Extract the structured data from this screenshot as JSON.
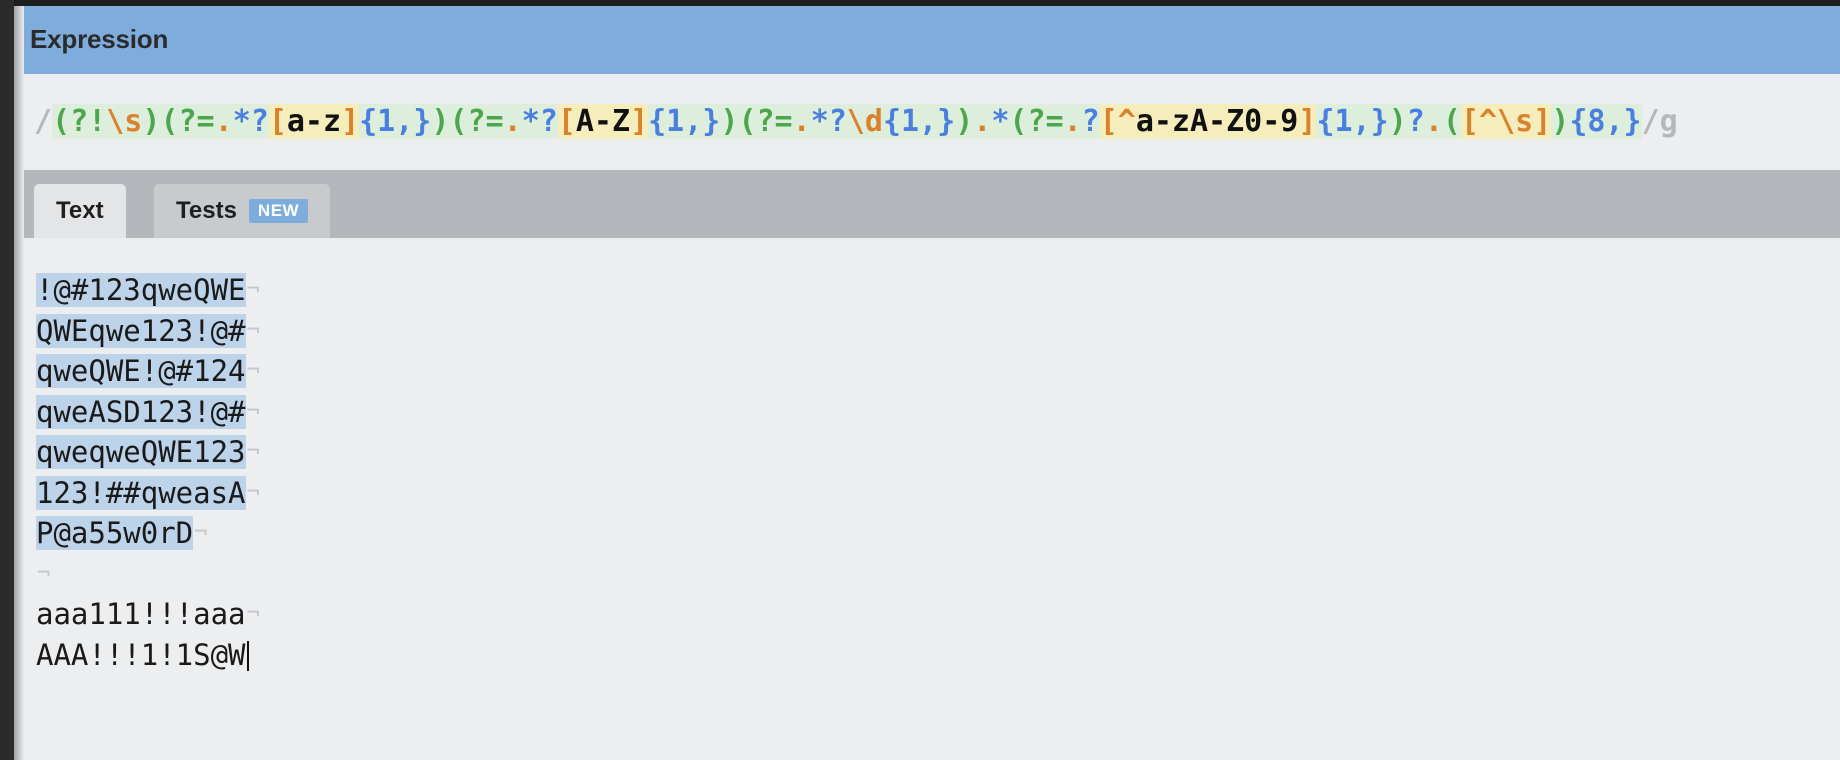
{
  "app": {
    "name": "regex-tester",
    "accent_color": "#7eaddd",
    "background_color": "#eceef0",
    "tabbar_color": "#b4b8bc",
    "match_highlight_color": "#bdd3ea"
  },
  "header": {
    "title": "Expression"
  },
  "expression": {
    "full_text": "/(?!\\s)(?=.*?[a-z]{1,})(?=.*?[A-Z]{1,})(?=.*?\\d{1,}).*(?=.?[^a-zA-Z0-9]{1,})?.([^\\s]){8,}/g",
    "open_delimiter": "/",
    "close_delimiter": "/",
    "flags": "g",
    "tokens": [
      {
        "text": "/",
        "kind": "delim"
      },
      {
        "text": "(",
        "kind": "group"
      },
      {
        "text": "?!",
        "kind": "group"
      },
      {
        "text": "\\s",
        "kind": "esc"
      },
      {
        "text": ")",
        "kind": "group"
      },
      {
        "text": "(",
        "kind": "group"
      },
      {
        "text": "?=",
        "kind": "group"
      },
      {
        "text": ".",
        "kind": "dot"
      },
      {
        "text": "*",
        "kind": "star"
      },
      {
        "text": "?",
        "kind": "qm"
      },
      {
        "text": "[",
        "kind": "esc-class"
      },
      {
        "text": "a-z",
        "kind": "lit-class"
      },
      {
        "text": "]",
        "kind": "esc-class"
      },
      {
        "text": "{1,}",
        "kind": "meta"
      },
      {
        "text": ")",
        "kind": "group"
      },
      {
        "text": "(",
        "kind": "group"
      },
      {
        "text": "?=",
        "kind": "group"
      },
      {
        "text": ".",
        "kind": "dot"
      },
      {
        "text": "*",
        "kind": "star"
      },
      {
        "text": "?",
        "kind": "qm"
      },
      {
        "text": "[",
        "kind": "esc-class"
      },
      {
        "text": "A-Z",
        "kind": "lit-class"
      },
      {
        "text": "]",
        "kind": "esc-class"
      },
      {
        "text": "{1,}",
        "kind": "meta"
      },
      {
        "text": ")",
        "kind": "group"
      },
      {
        "text": "(",
        "kind": "group"
      },
      {
        "text": "?=",
        "kind": "group"
      },
      {
        "text": ".",
        "kind": "dot"
      },
      {
        "text": "*",
        "kind": "star"
      },
      {
        "text": "?",
        "kind": "qm"
      },
      {
        "text": "\\d",
        "kind": "esc"
      },
      {
        "text": "{1,}",
        "kind": "meta"
      },
      {
        "text": ")",
        "kind": "group"
      },
      {
        "text": ".",
        "kind": "dot"
      },
      {
        "text": "*",
        "kind": "star"
      },
      {
        "text": "(",
        "kind": "group"
      },
      {
        "text": "?=",
        "kind": "group"
      },
      {
        "text": ".",
        "kind": "dot"
      },
      {
        "text": "?",
        "kind": "qm"
      },
      {
        "text": "[",
        "kind": "esc-class"
      },
      {
        "text": "^",
        "kind": "esc-class"
      },
      {
        "text": "a-zA-Z0-9",
        "kind": "lit-class"
      },
      {
        "text": "]",
        "kind": "esc-class"
      },
      {
        "text": "{1,}",
        "kind": "meta"
      },
      {
        "text": ")",
        "kind": "group"
      },
      {
        "text": "?",
        "kind": "qm"
      },
      {
        "text": ".",
        "kind": "dot"
      },
      {
        "text": "(",
        "kind": "group"
      },
      {
        "text": "[",
        "kind": "esc-class"
      },
      {
        "text": "^",
        "kind": "esc-class"
      },
      {
        "text": "\\s",
        "kind": "esc-class"
      },
      {
        "text": "]",
        "kind": "esc-class"
      },
      {
        "text": ")",
        "kind": "group"
      },
      {
        "text": "{8,}",
        "kind": "meta"
      },
      {
        "text": "/",
        "kind": "delim"
      },
      {
        "text": "g",
        "kind": "delim"
      }
    ]
  },
  "tabs": [
    {
      "id": "text",
      "label": "Text",
      "active": true,
      "badge": null
    },
    {
      "id": "tests",
      "label": "Tests",
      "active": false,
      "badge": "NEW"
    }
  ],
  "test_text": {
    "lines": [
      {
        "text": "!@#123qweQWE",
        "matched": true,
        "break_marker": true
      },
      {
        "text": "QWEqwe123!@#",
        "matched": true,
        "break_marker": true
      },
      {
        "text": "qweQWE!@#124",
        "matched": true,
        "break_marker": true
      },
      {
        "text": "qweASD123!@#",
        "matched": true,
        "break_marker": true
      },
      {
        "text": "qweqweQWE123",
        "matched": true,
        "break_marker": true
      },
      {
        "text": "123!##qweasA",
        "matched": true,
        "break_marker": true
      },
      {
        "text": "P@a55w0rD",
        "matched": true,
        "break_marker": true
      },
      {
        "text": "",
        "matched": false,
        "break_marker": true
      },
      {
        "text": "aaa111!!!aaa",
        "matched": false,
        "break_marker": true
      },
      {
        "text": "AAA!!!1!1S@W",
        "matched": false,
        "break_marker": false,
        "caret": true
      }
    ],
    "break_marker_glyph": "¬"
  }
}
